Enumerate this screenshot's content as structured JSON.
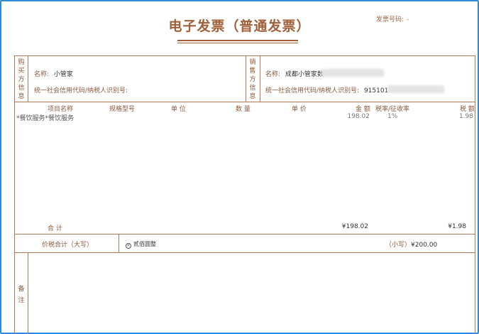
{
  "invoice": {
    "title": "电子发票（普通发票）",
    "number_label": "发票号码:",
    "number_value": "-"
  },
  "buyer": {
    "section_label": [
      "购",
      "买",
      "方",
      "信",
      "息"
    ],
    "name_label": "名称:",
    "name_value": "小管家",
    "tax_id_label": "统一社会信用代码/纳税人识别号:",
    "tax_id_value": ""
  },
  "seller": {
    "section_label": [
      "销",
      "售",
      "方",
      "信",
      "息"
    ],
    "name_label": "名称:",
    "name_value": "成都小管家数",
    "tax_id_label": "统一社会信用代码/纳税人识别号:",
    "tax_id_value": "915101"
  },
  "items": {
    "headers": {
      "name": "项目名称",
      "spec": "规格型号",
      "unit": "单 位",
      "qty": "数 量",
      "price": "单 价",
      "amount": "金 额",
      "rate": "税率/征收率",
      "tax": "税 额"
    },
    "rows": [
      {
        "name": "*餐饮服务*餐饮服务",
        "amount": "198.02",
        "rate": "1%",
        "tax": "1.98"
      }
    ]
  },
  "totals": {
    "label": "合 计",
    "amount": "¥198.02",
    "tax": "¥1.98",
    "grand_label": "价税合计（大写）",
    "grand_words": "贰佰圆整",
    "grand_small_label": "（小写）",
    "grand_small_value": "¥200.00"
  },
  "remarks": {
    "label": [
      "备",
      "注"
    ]
  },
  "colors": {
    "frame": "#2f8be0",
    "accent": "#a0603a",
    "border": "#b07a57"
  }
}
